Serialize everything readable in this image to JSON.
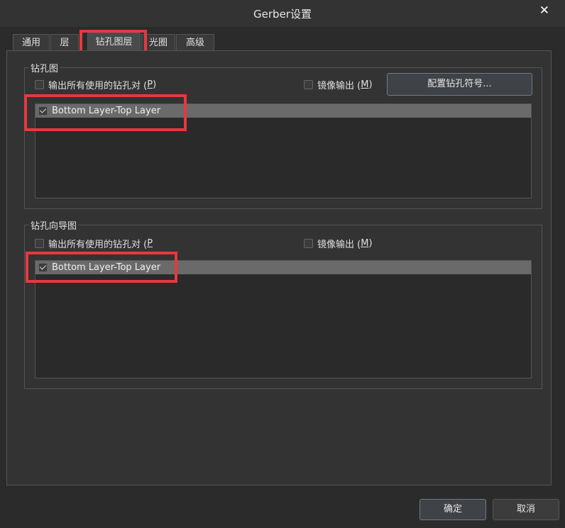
{
  "window": {
    "title": "Gerber设置",
    "close_glyph": "✕"
  },
  "tabs": [
    {
      "label": "通用"
    },
    {
      "label": "层"
    },
    {
      "label": "钻孔图层"
    },
    {
      "label": "光圈"
    },
    {
      "label": "高级"
    }
  ],
  "drill_drawing": {
    "group_title": "钻孔图",
    "output_all_label": "输出所有使用的钻孔对 (",
    "output_all_mnemonic": "P",
    "output_all_suffix": ")",
    "mirror_label": "镜像输出 (",
    "mirror_mnemonic": "M",
    "mirror_suffix": ")",
    "config_button": "配置钻孔符号...",
    "layer_pairs": [
      {
        "label": "Bottom Layer-Top Layer",
        "checked": true
      }
    ]
  },
  "drill_guide": {
    "group_title": "钻孔向导图",
    "output_all_label": "输出所有使用的钻孔对 (",
    "output_all_mnemonic": "P",
    "mirror_label": "镜像输出 (",
    "mirror_mnemonic": "M",
    "mirror_suffix": ")",
    "layer_pairs": [
      {
        "label": "Bottom Layer-Top Layer",
        "checked": true
      }
    ]
  },
  "footer": {
    "ok_label": "确定",
    "cancel_label": "取消"
  },
  "colors": {
    "highlight": "#e8383d",
    "accent_border": "#6b7c8c"
  }
}
